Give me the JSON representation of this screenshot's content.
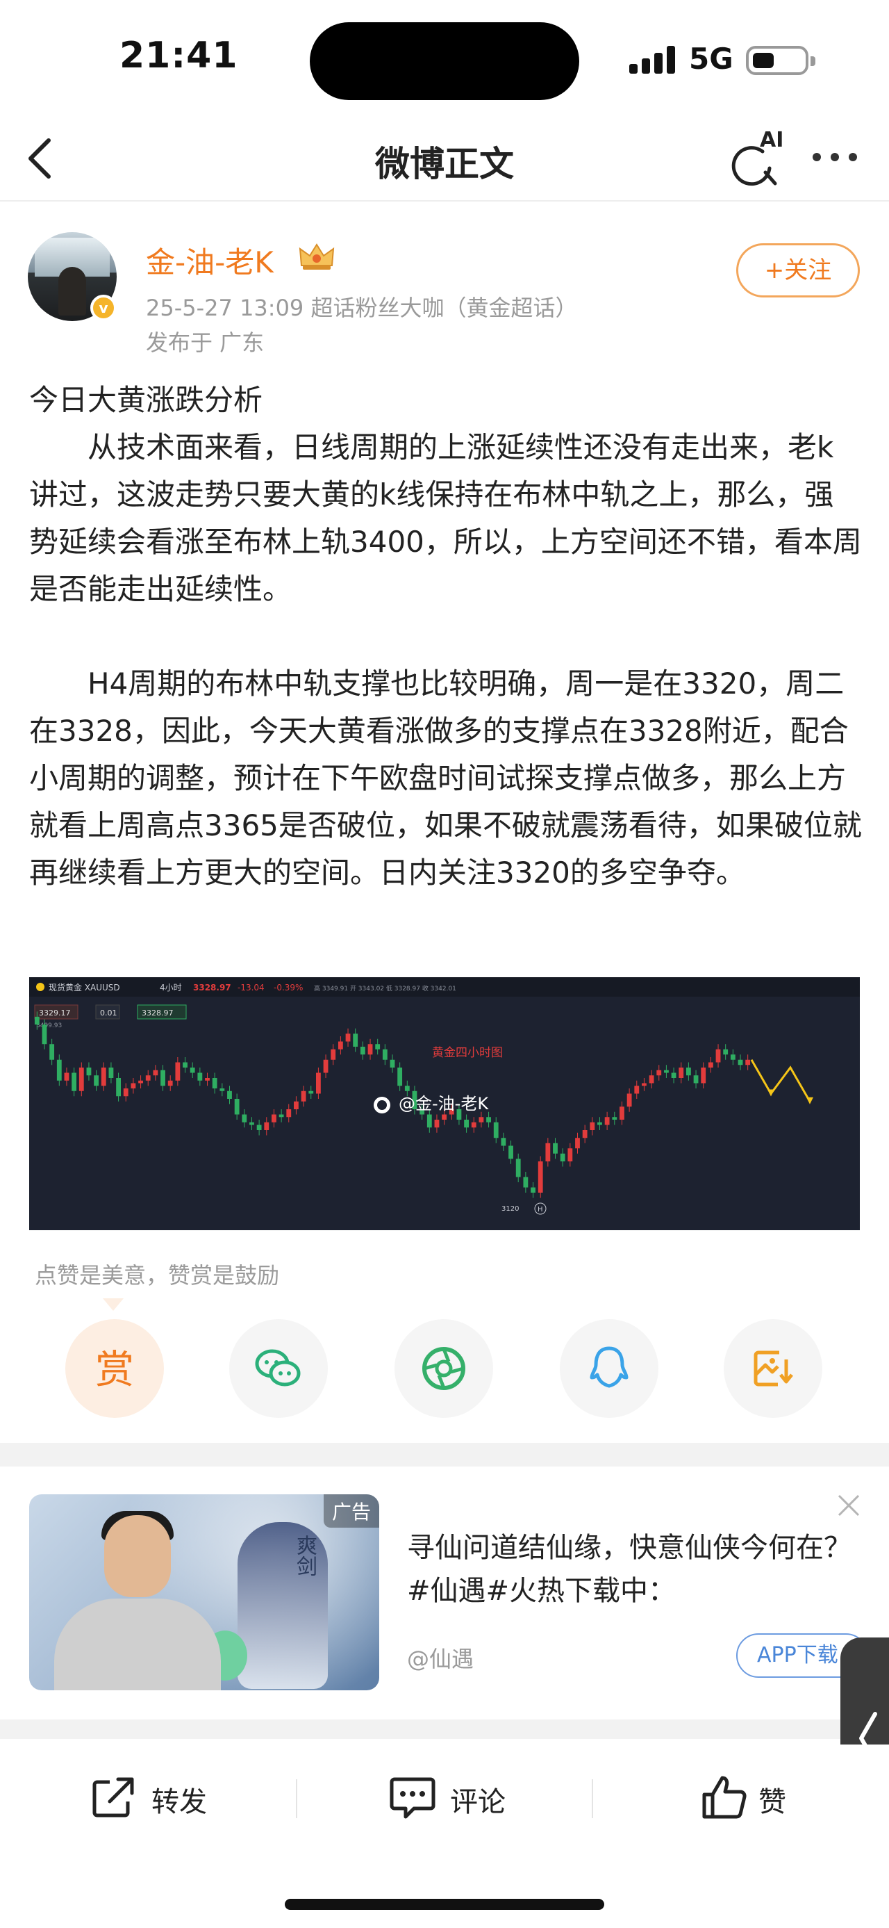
{
  "status_bar": {
    "time": "21:41",
    "network": "5G"
  },
  "nav": {
    "title": "微博正文",
    "ai_label": "AI"
  },
  "author": {
    "name": "金-油-老K",
    "meta": "25-5-27 13:09  超话粉丝大咖（黄金超话）",
    "location": "发布于 广东",
    "verified_mark": "v",
    "follow_label": "+关注"
  },
  "post": {
    "heading": "今日大黄涨跌分析",
    "para1": "从技术面来看，日线周期的上涨延续性还没有走出来，老k讲过，这波走势只要大黄的k线保持在布林中轨之上，那么，强势延续会看涨至布林上轨3400，所以，上方空间还不错，看本周是否能走出延续性。",
    "para2": "H4周期的布林中轨支撑也比较明确，周一是在3320，周二在3328，因此，今天大黄看涨做多的支撑点在3328附近，配合小周期的调整，预计在下午欧盘时间试探支撑点做多，那么上方就看上周高点3365是否破位，如果不破就震荡看待，如果破位就再继续看上方更大的空间。日内关注3320的多空争夺。"
  },
  "chart_data": {
    "type": "candlestick",
    "symbol_label": "现货黄金 XAUUSD",
    "timeframe": "4小时",
    "last_price": "3328.97",
    "change": "-13.04",
    "change_pct": "-0.39%",
    "ohlc_text": "高 3349.91  开 3343.02  低 3328.97  收 3342.01",
    "price_box_1": "3329.17",
    "price_box_2": "0.01",
    "price_box_3": "3328.97",
    "price_box_4": "3499.93",
    "chart_title": "黄金四小时图",
    "watermark": "@金-油-老K",
    "low_marker": "3120",
    "h_marker": "H",
    "close_prices": [
      3425,
      3410,
      3398,
      3382,
      3388,
      3374,
      3392,
      3386,
      3378,
      3392,
      3384,
      3370,
      3376,
      3380,
      3382,
      3386,
      3390,
      3378,
      3382,
      3396,
      3392,
      3388,
      3382,
      3384,
      3376,
      3374,
      3368,
      3356,
      3350,
      3348,
      3344,
      3350,
      3356,
      3354,
      3360,
      3366,
      3374,
      3372,
      3388,
      3398,
      3406,
      3412,
      3418,
      3408,
      3402,
      3410,
      3406,
      3398,
      3392,
      3378,
      3374,
      3360,
      3356,
      3346,
      3352,
      3356,
      3360,
      3352,
      3346,
      3350,
      3354,
      3350,
      3338,
      3332,
      3322,
      3308,
      3300,
      3296,
      3320,
      3334,
      3326,
      3320,
      3330,
      3338,
      3344,
      3350,
      3348,
      3354,
      3352,
      3362,
      3372,
      3378,
      3380,
      3386,
      3390,
      3388,
      3384,
      3392,
      3386,
      3380,
      3392,
      3396,
      3406,
      3402,
      3398,
      3394,
      3398
    ],
    "projection_points": [
      3398,
      3372,
      3392,
      3366
    ],
    "colors": {
      "up": "#e23c3c",
      "down": "#2fae62",
      "projection": "#f5c518",
      "title": "#e23c3c"
    }
  },
  "encourage_text": "点赞是美意，赞赏是鼓励",
  "share": {
    "reward_label": "赏",
    "items": [
      "wechat-icon",
      "moments-icon",
      "qq-icon",
      "save-image-icon"
    ]
  },
  "ad": {
    "tag": "广告",
    "title": "寻仙问道结仙缘，快意仙侠今何在？#仙遇#火热下载中：",
    "source": "@仙遇",
    "button_label": "APP下载",
    "game_title_art": "爽剑"
  },
  "bottom_bar": {
    "repost": "转发",
    "comment": "评论",
    "like": "赞"
  }
}
